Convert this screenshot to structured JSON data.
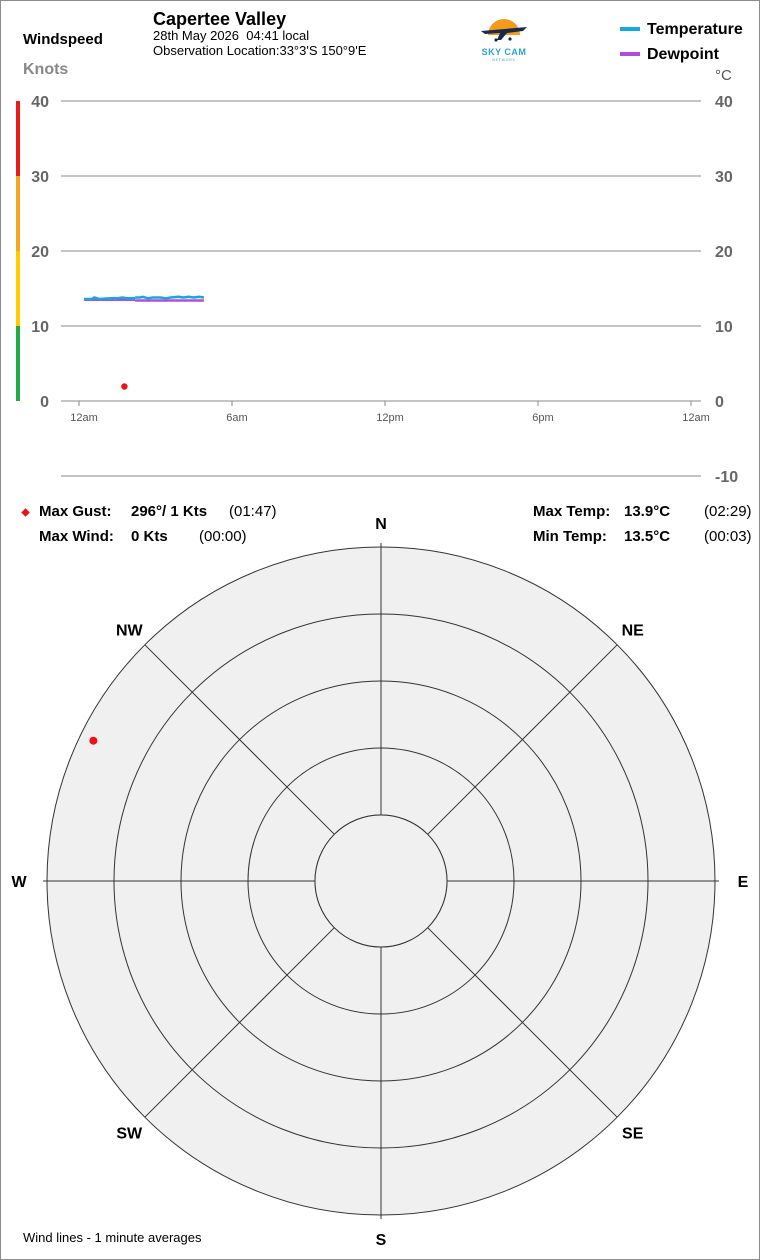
{
  "header": {
    "title": "Capertee Valley",
    "date": "28th May 2026",
    "time": "04:41 local",
    "location_label": "Observation Location:",
    "location": "33°3'S 150°9'E",
    "left_axis_title": "Windspeed",
    "left_axis_unit": "Knots",
    "right_axis_unit": "°C"
  },
  "logo": {
    "text": "SKY CAM",
    "subtext": "NETWORK",
    "icon": "plane-sun-logo-icon"
  },
  "legend": [
    {
      "label": "Temperature",
      "color": "#16a7dc"
    },
    {
      "label": "Dewpoint",
      "color": "#b04de0"
    }
  ],
  "stats": {
    "max_gust_label": "Max Gust:",
    "max_gust_value": "296°/ 1 Kts",
    "max_gust_time": "(01:47)",
    "max_wind_label": "Max Wind:",
    "max_wind_value": "0 Kts",
    "max_wind_time": "(00:00)",
    "max_temp_label": "Max Temp:",
    "max_temp_value": "13.9°C",
    "max_temp_time": "(02:29)",
    "min_temp_label": "Min Temp:",
    "min_temp_value": "13.5°C",
    "min_temp_time": "(00:03)"
  },
  "footnote": "Wind lines - 1 minute averages",
  "colors": {
    "gust_marker": "#ee1111",
    "speed_bands": [
      "#22aa44",
      "#ffcc00",
      "#f5a623",
      "#e81a1a"
    ],
    "grid": "#8a8a8a",
    "rose_fill": "#f0f0f0"
  },
  "chart_data": [
    {
      "type": "line",
      "title": "",
      "x_tick_labels": [
        "12am",
        "6am",
        "12pm",
        "6pm",
        "12am"
      ],
      "x_range_hours": [
        0,
        24
      ],
      "y_left_ticks": [
        0,
        10,
        20,
        30,
        40
      ],
      "y_left_range": [
        0,
        40
      ],
      "y_right_ticks": [
        -10,
        0,
        10,
        20,
        30,
        40
      ],
      "y_right_range": [
        -10,
        40
      ],
      "grid": true,
      "speed_band_edges": [
        0,
        10,
        20,
        30,
        40
      ],
      "series": [
        {
          "name": "Temperature",
          "color": "#16a7dc",
          "segments": [
            {
              "x": [
                0.2,
                0.5,
                0.6,
                0.8,
                1.2
              ],
              "y": [
                13.6,
                13.6,
                13.8,
                13.6,
                13.7
              ]
            },
            {
              "x": [
                1.2,
                1.5,
                1.7,
                1.9,
                2.2
              ],
              "y": [
                13.7,
                13.7,
                13.8,
                13.7,
                13.7
              ]
            },
            {
              "x": [
                2.2,
                2.4,
                2.5,
                2.7,
                2.9,
                3.2,
                3.4,
                3.6,
                3.9,
                4.1,
                4.3,
                4.5,
                4.7,
                4.9
              ],
              "y": [
                13.8,
                13.8,
                13.9,
                13.7,
                13.8,
                13.8,
                13.7,
                13.8,
                13.9,
                13.8,
                13.9,
                13.8,
                13.9,
                13.8
              ]
            }
          ]
        },
        {
          "name": "Dewpoint",
          "color": "#b04de0",
          "segments": [
            {
              "x": [
                0.2,
                0.8,
                1.2
              ],
              "y": [
                13.5,
                13.5,
                13.5
              ]
            },
            {
              "x": [
                1.2,
                1.7,
                2.2
              ],
              "y": [
                13.5,
                13.5,
                13.5
              ]
            },
            {
              "x": [
                2.2,
                3.5,
                4.9
              ],
              "y": [
                13.4,
                13.4,
                13.4
              ]
            }
          ]
        }
      ],
      "gust_points": [
        {
          "x": 1.78,
          "y_knots": 1
        }
      ],
      "wind_average_points": []
    },
    {
      "type": "scatter",
      "title": "",
      "rose_labels": [
        "N",
        "NE",
        "E",
        "SE",
        "S",
        "SW",
        "W",
        "NW"
      ],
      "rings_knots": [
        10,
        20,
        30,
        40,
        50
      ],
      "gust_points": [
        {
          "direction_deg": 296,
          "speed_knots": 1
        }
      ]
    }
  ]
}
